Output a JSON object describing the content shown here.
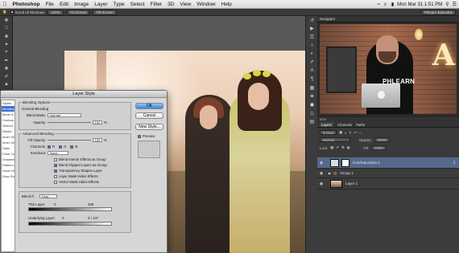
{
  "menubar": {
    "app_name": "Photoshop",
    "menus": [
      "File",
      "Edit",
      "Image",
      "Layer",
      "Type",
      "Select",
      "Filter",
      "3D",
      "View",
      "Window",
      "Help"
    ],
    "clock": "Mon Mar 31  1:51 PM"
  },
  "options_bar": {
    "scroll_all_windows": "Scroll All Windows",
    "zoom_100": "100%",
    "fit_screen": "Fit Screen",
    "fill_screen": "Fill Screen",
    "workspace": "Phlearn Episodes"
  },
  "dialog": {
    "title": "Layer Style",
    "styles": [
      "Styles",
      "Blending Options: Custom",
      "Bevel & Emboss",
      "Contour",
      "Texture",
      "Stroke",
      "Inner Shadow",
      "Inner Glow",
      "Satin",
      "Color Overlay",
      "Gradient Overlay",
      "Pattern Overlay",
      "Outer Glow",
      "Drop Shadow"
    ],
    "blending_options": "Blending Options",
    "general_blending": "General Blending",
    "blend_mode_label": "Blend Mode:",
    "blend_mode_value": "Normal",
    "opacity_label": "Opacity:",
    "opacity_value": "100",
    "pct": "%",
    "advanced_blending": "Advanced Blending",
    "fill_opacity_label": "Fill Opacity:",
    "fill_opacity_value": "100",
    "channels_label": "Channels:",
    "channel_r": "R",
    "channel_g": "G",
    "channel_b": "B",
    "knockout_label": "Knockout:",
    "knockout_value": "None",
    "options": [
      {
        "label": "Blend Interior Effects as Group",
        "checked": false
      },
      {
        "label": "Blend Clipped Layers as Group",
        "checked": true
      },
      {
        "label": "Transparency Shapes Layer",
        "checked": true
      },
      {
        "label": "Layer Mask Hides Effects",
        "checked": false
      },
      {
        "label": "Vector Mask Hides Effects",
        "checked": false
      }
    ],
    "blend_if_label": "Blend If:",
    "blend_if_value": "Gray",
    "this_layer_label": "This Layer:",
    "this_layer_low": "0",
    "this_layer_high": "255",
    "underlying_label": "Underlying Layer:",
    "underlying_low": "0",
    "underlying_high": "0  /  137",
    "buttons": {
      "ok": "OK",
      "cancel": "Cancel",
      "new_style": "New Style...",
      "preview": "Preview"
    }
  },
  "navigator": {
    "title": "Navigator",
    "zoom": "50%",
    "video_shirt_text": "PHLEARN",
    "video_sign": "A"
  },
  "layers_panel": {
    "tabs": [
      "Layers",
      "Channels",
      "Paths"
    ],
    "kind_label": "Kind",
    "mode": "Normal",
    "opacity_label": "Opacity:",
    "opacity_value": "100%",
    "lock_label": "Lock:",
    "fill_label": "Fill:",
    "fill_value": "100%",
    "layers": [
      {
        "name": "Hue/Saturation 2",
        "selected": true
      },
      {
        "name": "Group 1",
        "selected": false
      },
      {
        "name": "Layer 1",
        "selected": false
      }
    ]
  }
}
